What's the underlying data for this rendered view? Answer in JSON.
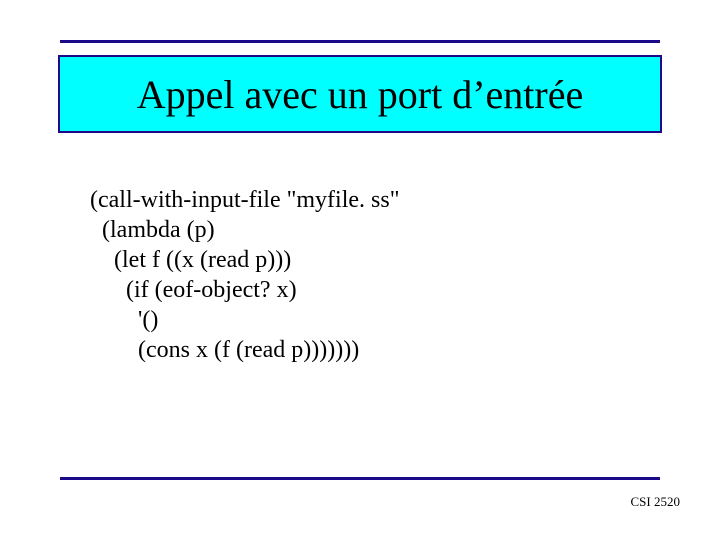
{
  "title": "Appel avec un port d’entrée",
  "code": {
    "l1": "(call-with-input-file \"myfile. ss\"",
    "l2": "  (lambda (p)",
    "l3": "    (let f ((x (read p)))",
    "l4": "      (if (eof-object? x)",
    "l5": "        '()",
    "l6": "        (cons x (f (read p)))))))"
  },
  "footer": "CSI 2520"
}
